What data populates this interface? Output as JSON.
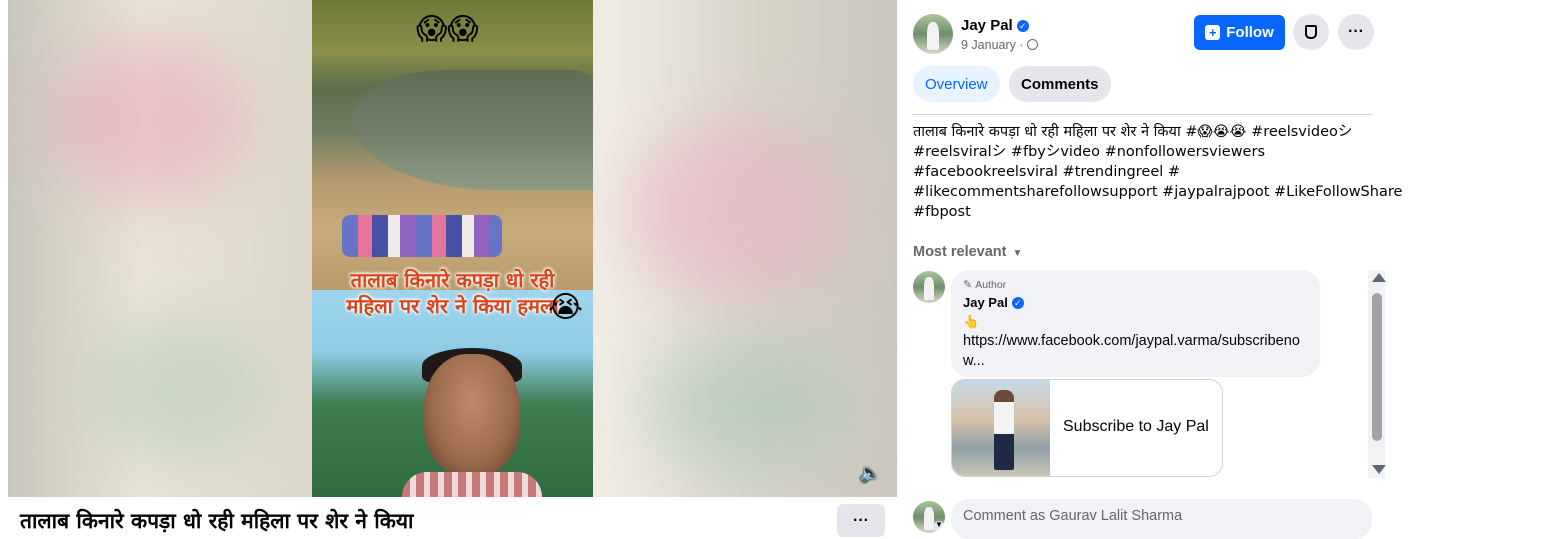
{
  "video": {
    "overlay_emoji_top": "😱😱",
    "overlay_caption_line1": "तालाब किनारे कपड़ा धो रही",
    "overlay_caption_line2": "महिला पर शेर ने किया हमला",
    "overlay_caption_emoji": "😭",
    "mute_icon": "🔈",
    "title": "तालाब किनारे कपड़ा धो रही महिला पर शेर ने किया",
    "more_label": "···"
  },
  "post": {
    "author": "Jay Pal",
    "verified_mark": "✓",
    "date": "9 January ·",
    "follow_label": "Follow",
    "follow_icon": "+",
    "more_label": "···",
    "tabs": [
      {
        "label": "Overview",
        "active": true
      },
      {
        "label": "Comments",
        "active": false
      }
    ],
    "caption_lines": [
      "तालाब किनारे कपड़ा धो रही महिला पर शेर ने किया #😱😭😭 #reelsvideoシ",
      "#reelsviralシ #fbyシvideo #nonfollowersviewers",
      "#facebookreelsviral #trendingreel #",
      "#likecommentsharefollowsupport #jaypalrajpoot #LikeFollowShare",
      "#fbpost"
    ]
  },
  "comments": {
    "sort_label": "Most relevant",
    "items": [
      {
        "author_tag": "Author",
        "name": "Jay Pal",
        "emoji": "👆",
        "link_text": "https://www.facebook.com/jaypal.varma/subscribenow...",
        "card_label": "Subscribe to Jay Pal"
      }
    ],
    "input_placeholder": "Comment as Gaurav Lalit Sharma"
  },
  "colors": {
    "accent": "#0866ff",
    "muted_text": "#65676b",
    "chip_bg": "#e4e6eb",
    "bubble_bg": "#f0f2f5"
  },
  "icons": [
    "mute-icon",
    "verified-icon",
    "globe-icon",
    "follow-icon",
    "bookmark-icon",
    "more-icon",
    "caret-down-icon",
    "pencil-icon",
    "scroll-up-icon",
    "scroll-down-icon"
  ]
}
